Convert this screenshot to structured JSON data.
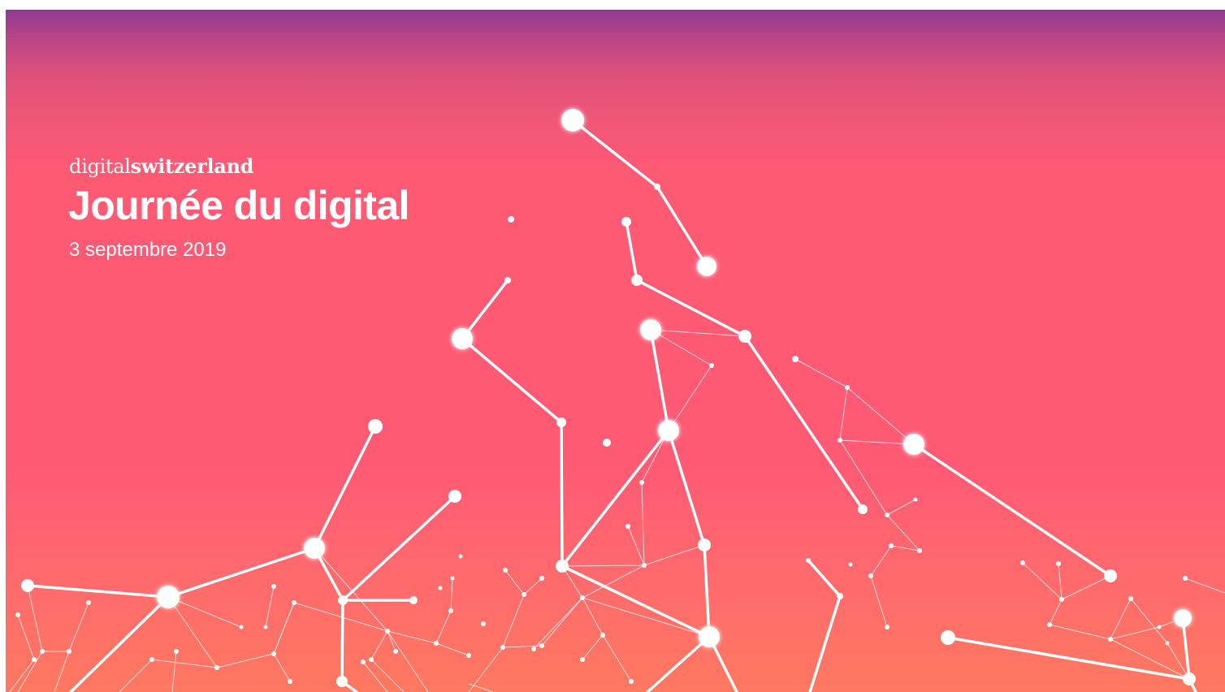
{
  "banner": {
    "brand_light": "digital",
    "brand_bold": "switzerland",
    "title": "Journée du digital",
    "date": "3 septembre 2019"
  },
  "colors": {
    "top": "#8c3a93",
    "main": "#ff5a74",
    "bottom": "#ff7860",
    "network": "#ffffff"
  }
}
